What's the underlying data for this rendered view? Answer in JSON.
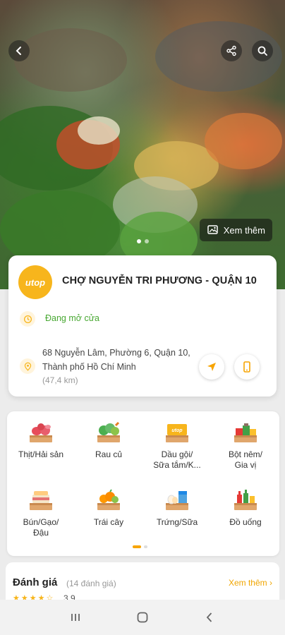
{
  "store": {
    "logo_text": "utop",
    "name": "CHỢ NGUYỄN TRI PHƯƠNG - QUẬN 10",
    "open_status": "Đang mở cửa",
    "address": "68 Nguyễn Lâm, Phường 6, Quận 10, Thành phố Hồ Chí Minh",
    "distance": "(47,4 km)"
  },
  "hero": {
    "more_photos_label": "Xem thêm",
    "photo_count": 2,
    "active_photo": 1
  },
  "categories": [
    {
      "label": "Thịt/Hải sản",
      "icon": "meat-seafood-icon"
    },
    {
      "label": "Rau củ",
      "icon": "vegetables-icon"
    },
    {
      "label": "Dầu gội/\nSữa tắm/K...",
      "icon": "shampoo-icon"
    },
    {
      "label": "Bột nêm/\nGia vị",
      "icon": "seasoning-icon"
    },
    {
      "label": "Bún/Gạo/\nĐậu",
      "icon": "rice-noodle-icon"
    },
    {
      "label": "Trái cây",
      "icon": "fruit-icon"
    },
    {
      "label": "Trứng/Sữa",
      "icon": "egg-milk-icon"
    },
    {
      "label": "Đồ uống",
      "icon": "drinks-icon"
    }
  ],
  "reviews": {
    "title": "Đánh giá",
    "count": "(14 đánh giá)",
    "see_more": "Xem thêm",
    "rating": "3.9",
    "stars": 3.9
  },
  "colors": {
    "accent": "#f7b51c",
    "open": "#48a832",
    "see_more": "#f0a500"
  }
}
